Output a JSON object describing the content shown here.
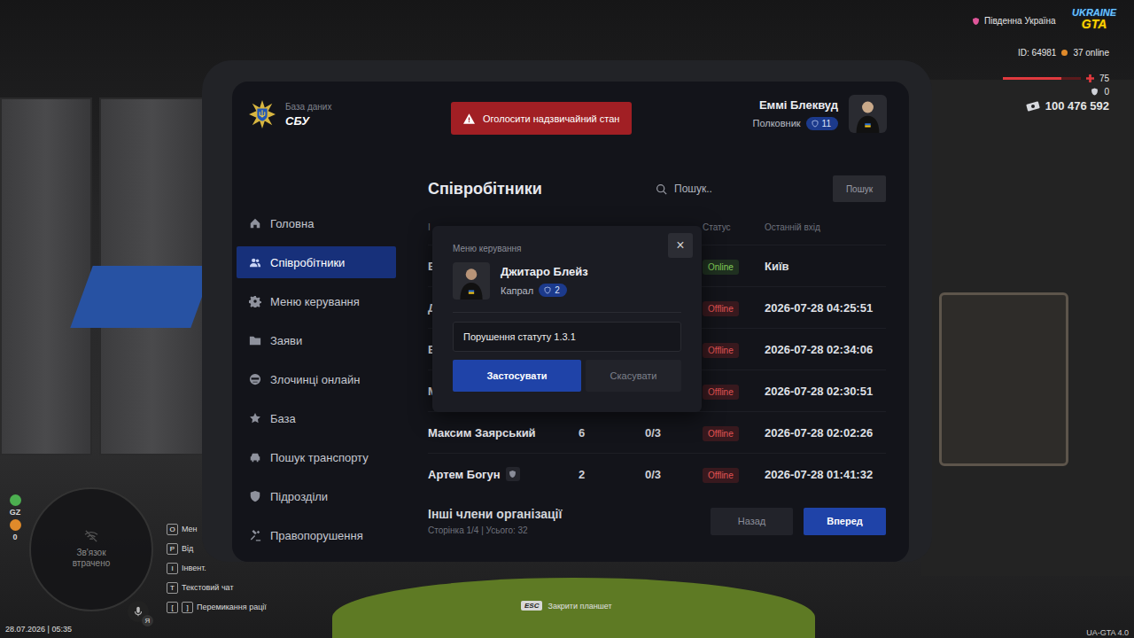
{
  "hud": {
    "region": "Південна Україна",
    "logo": {
      "top": "UKRAINE",
      "bottom": "GTA"
    },
    "id": "ID: 64981",
    "online": "37 online",
    "health": {
      "value": "75",
      "level": 0.75
    },
    "armor": "0",
    "money": "100 476 592",
    "indicators": [
      {
        "label": "GZ",
        "color": "#4caf50"
      },
      {
        "label": "0",
        "color": "#e08a2a"
      }
    ],
    "minimap": "Зв'язок втрачено",
    "keybinds": [
      {
        "keys": [
          "O"
        ],
        "label": "Мен"
      },
      {
        "keys": [
          "P"
        ],
        "label": "Від"
      },
      {
        "keys": [
          "I"
        ],
        "label": "Інвент."
      },
      {
        "keys": [
          "T"
        ],
        "label": "Текстовий чат"
      },
      {
        "keys": [
          "[",
          "]"
        ],
        "label": "Перемикання рації"
      }
    ],
    "voice_badge": "Я",
    "datetime": "28.07.2026 | 05:35",
    "close_hint": {
      "key": "ESC",
      "label": "Закрити планшет"
    },
    "version": "UA-GTA 4.0"
  },
  "tablet": {
    "brand": {
      "subtitle": "База даних",
      "title": "СБУ"
    },
    "emergency_button": "Оголосити надзвичайний стан",
    "user": {
      "name": "Еммі Блеквуд",
      "rank": "Полковник",
      "level": "11"
    },
    "sidebar": [
      {
        "label": "Головна",
        "selected": false
      },
      {
        "label": "Співробітники",
        "selected": true
      },
      {
        "label": "Меню керування",
        "selected": false
      },
      {
        "label": "Заяви",
        "selected": false
      },
      {
        "label": "Злочинці онлайн",
        "selected": false
      },
      {
        "label": "База",
        "selected": false
      },
      {
        "label": "Пошук транспорту",
        "selected": false
      },
      {
        "label": "Підрозділи",
        "selected": false
      },
      {
        "label": "Правопорушення",
        "selected": false
      }
    ],
    "page_title": "Співробітники",
    "search": {
      "placeholder": "Пошук..",
      "button": "Пошук"
    },
    "table": {
      "columns": [
        "І",
        "",
        "",
        "Статус",
        "Останній вхід"
      ],
      "rows": [
        {
          "name": "Е",
          "rank": "",
          "warns": "",
          "status": "Online",
          "online": true,
          "last": "Київ",
          "badge": false
        },
        {
          "name": "Д",
          "rank": "",
          "warns": "",
          "status": "Offline",
          "online": false,
          "last": "2026-07-28 04:25:51",
          "badge": false
        },
        {
          "name": "Е",
          "rank": "",
          "warns": "",
          "status": "Offline",
          "online": false,
          "last": "2026-07-28 02:34:06",
          "badge": false
        },
        {
          "name": "М",
          "rank": "",
          "warns": "",
          "status": "Offline",
          "online": false,
          "last": "2026-07-28 02:30:51",
          "badge": false
        },
        {
          "name": "Максим Заярський",
          "rank": "6",
          "warns": "0/3",
          "status": "Offline",
          "online": false,
          "last": "2026-07-28 02:02:26",
          "badge": false
        },
        {
          "name": "Артем Богун",
          "rank": "2",
          "warns": "0/3",
          "status": "Offline",
          "online": false,
          "last": "2026-07-28 01:41:32",
          "badge": true
        }
      ]
    },
    "footer": {
      "title": "Інші члени організації",
      "pages": "Сторінка 1/4 | Усього: 32",
      "prev": "Назад",
      "next": "Вперед"
    },
    "modal": {
      "title": "Меню керування",
      "close": "×",
      "name": "Джитаро Блейз",
      "rank": "Капрал",
      "level": "2",
      "input_value": "Порушення статуту 1.3.1",
      "apply": "Застосувати",
      "cancel": "Скасувати"
    }
  }
}
